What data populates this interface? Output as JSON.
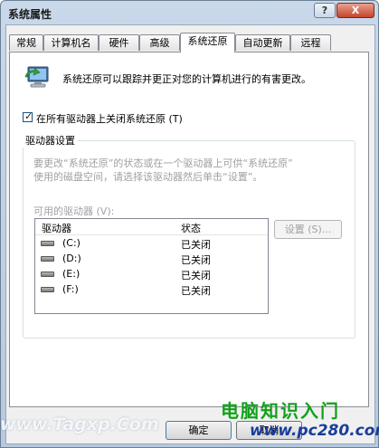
{
  "window": {
    "title": "系统属性",
    "help_label": "?",
    "close_label": "X"
  },
  "tabs": [
    {
      "label": "常规"
    },
    {
      "label": "计算机名"
    },
    {
      "label": "硬件"
    },
    {
      "label": "高级"
    },
    {
      "label": "系统还原"
    },
    {
      "label": "自动更新"
    },
    {
      "label": "远程"
    }
  ],
  "panel": {
    "intro": "系统还原可以跟踪并更正对您的计算机进行的有害更改。",
    "disable_checkbox": {
      "label": "在所有驱动器上关闭系统还原 (T)",
      "checked": true,
      "mark": "✓"
    },
    "group_title": "驱动器设置",
    "desc_line1": "要更改“系统还原”的状态或在一个驱动器上可供“系统还原”",
    "desc_line2": "使用的磁盘空间，请选择该驱动器然后单击“设置”。",
    "available_label": "可用的驱动器 (V):",
    "list": {
      "col_drive": "驱动器",
      "col_status": "状态",
      "rows": [
        {
          "drive": "(C:)",
          "status": "已关闭"
        },
        {
          "drive": "(D:)",
          "status": "已关闭"
        },
        {
          "drive": "(E:)",
          "status": "已关闭"
        },
        {
          "drive": "(F:)",
          "status": "已关闭"
        }
      ]
    },
    "settings_button": "设置 (S)..."
  },
  "buttons": {
    "ok": "确定",
    "cancel": "取消"
  },
  "watermarks": {
    "left": "www.Tagxp.Com",
    "right_cn": "电脑知识入门",
    "right_url": "www.pc280.com"
  },
  "colors": {
    "watermark_green": "#11a21a",
    "watermark_blue": "#1a3d99"
  }
}
